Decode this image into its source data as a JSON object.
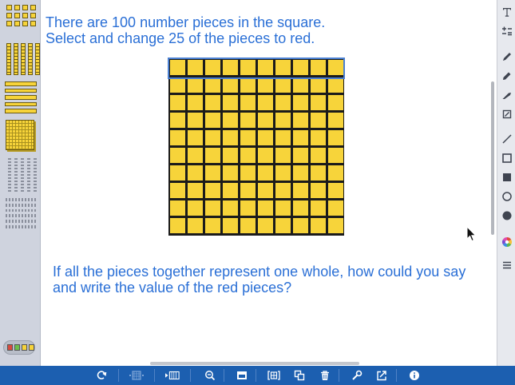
{
  "prompt": {
    "line1": "There are 100 number pieces in the square.",
    "line2": "Select and change 25 of the pieces to red."
  },
  "question": "If all the pieces together represent one whole, how could you say and write the value of the red pieces?",
  "grid": {
    "rows": 10,
    "columns": 10,
    "piece_color": "#f7d43a",
    "selected_row": 1
  },
  "colors": {
    "prompt_text": "#2a6fd6",
    "bottom_bar": "#1c5fb0",
    "piece": "#f7d43a",
    "selection": "#4a7fd1"
  },
  "left_palette": [
    "unit-pieces",
    "ten-rods-vertical",
    "ten-rods-horizontal",
    "hundred-flat",
    "outline-rods",
    "outline-flats",
    "color-picker"
  ],
  "right_toolbar": [
    "text-icon",
    "equation-icon",
    "pencil-icon",
    "marker-icon",
    "highlighter-icon",
    "eraser-icon",
    "line-icon",
    "rectangle-outline-icon",
    "rectangle-filled-icon",
    "circle-outline-icon",
    "circle-filled-icon",
    "color-wheel-icon",
    "menu-icon"
  ],
  "bottom_toolbar": [
    "rotate-icon",
    "grid-icon",
    "video-icon",
    "zoom-out-icon",
    "screen-icon",
    "group-icon",
    "duplicate-icon",
    "trash-icon",
    "wrench-icon",
    "share-icon",
    "info-icon"
  ]
}
